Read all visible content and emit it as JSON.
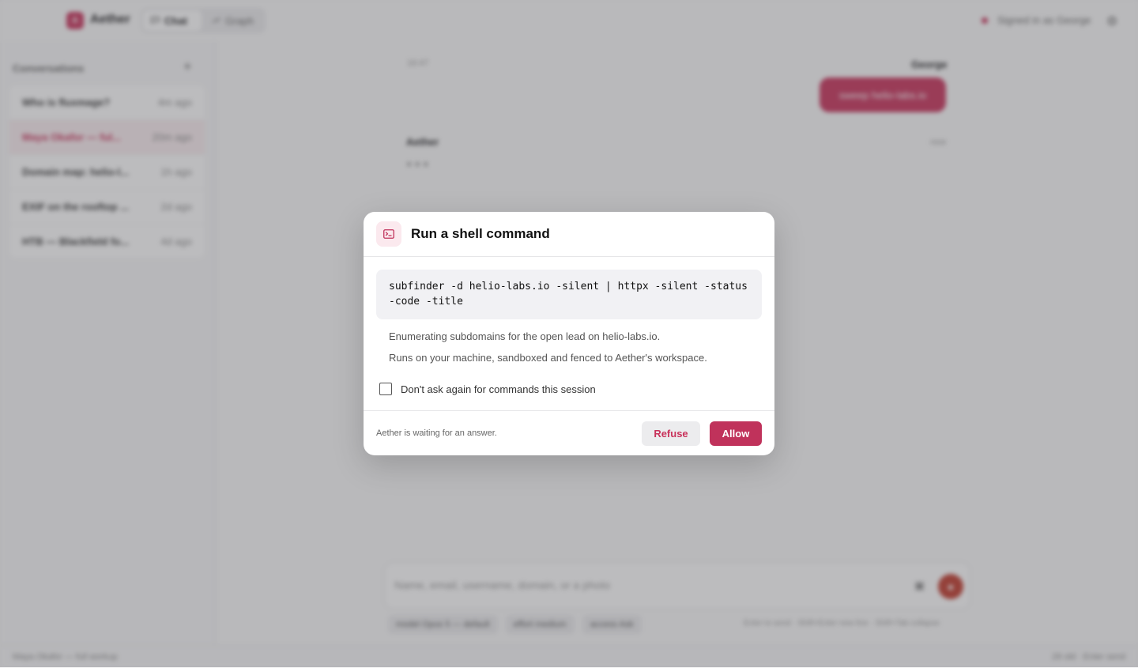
{
  "colors": {
    "accent": "#c0325b",
    "accent_soft": "#fbe9ee",
    "send": "#c0392b"
  },
  "header": {
    "logo_letter": "A",
    "brand": "Aether",
    "nav": [
      {
        "label": "Chat",
        "icon": "chat-bubble-icon"
      },
      {
        "label": "Graph",
        "icon": "graph-icon"
      }
    ],
    "signed_in": "Signed in as George",
    "settings_icon": "gear-icon"
  },
  "sidebar": {
    "title": "Conversations",
    "add": "+",
    "conversations": [
      {
        "name": "Who is fluxmage?",
        "time": "4m ago"
      },
      {
        "name": "Maya Okafor — ful...",
        "time": "20m ago"
      },
      {
        "name": "Domain map: helio-l...",
        "time": "1h ago"
      },
      {
        "name": "EXIF on the rooftop ...",
        "time": "2d ago"
      },
      {
        "name": "HTB — Blackfield fo...",
        "time": "4d ago"
      }
    ]
  },
  "chat": {
    "time_left": "16:47",
    "user_name": "George",
    "user_message": "sweep helio-labs.io",
    "assistant_name": "Aether",
    "assistant_time": "now",
    "typing": "● ● ●",
    "composer_placeholder": "Name, email, username, domain, or a photo",
    "attach_icon": "image-icon",
    "chips": [
      "model Opus 5 — default",
      "effort medium",
      "access Ask"
    ],
    "hint": "Enter to send · Shift+Enter new line · Shift+Tab collapse"
  },
  "footer": {
    "left": "Maya Okafor — full workup",
    "right": "28 old · Enter send"
  },
  "modal": {
    "icon": "terminal-icon",
    "title": "Run a shell command",
    "command": "subfinder -d helio-labs.io -silent | httpx -silent -status-code -title",
    "description_1": "Enumerating subdomains for the open lead on helio-labs.io.",
    "description_2": "Runs on your machine, sandboxed and fenced to Aether's workspace.",
    "checkbox_label": "Don't ask again for commands this session",
    "waiting": "Aether is waiting for an answer.",
    "refuse_label": "Refuse",
    "allow_label": "Allow"
  }
}
